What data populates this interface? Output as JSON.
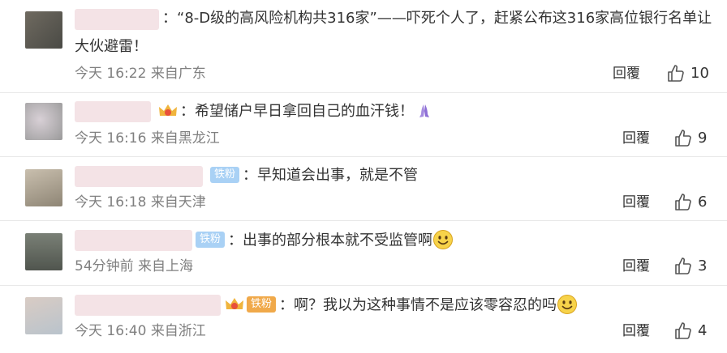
{
  "comments": [
    {
      "separator": "：",
      "text": "“8-D级的高风险机构共316家”——吓死个人了，赶紧公布这316家高位银行名单让",
      "text2": "大伙避雷！",
      "time": "今天 16:22",
      "location": "来自广东",
      "reply_label": "回覆",
      "likes": "10"
    },
    {
      "separator": "：",
      "text": "希望储户早日拿回自己的血汗钱！",
      "time": "今天 16:16",
      "location": "来自黑龙江",
      "reply_label": "回覆",
      "likes": "9"
    },
    {
      "badge": "铁粉",
      "separator": "：",
      "text": "早知道会出事，就是不管",
      "time": "今天 16:18",
      "location": "来自天津",
      "reply_label": "回覆",
      "likes": "6"
    },
    {
      "badge": "铁粉",
      "separator": "：",
      "text": "出事的部分根本就不受监管啊",
      "time": "54分钟前",
      "location": "来自上海",
      "reply_label": "回覆",
      "likes": "3"
    },
    {
      "badge": "铁粉",
      "separator": "：",
      "text": "啊？我以为这种事情不是应该零容忍的吗",
      "time": "今天 16:40",
      "location": "来自浙江",
      "reply_label": "回覆",
      "likes": "4"
    }
  ],
  "colors": {
    "badge": "#a9d1f5",
    "meta_text": "#808080",
    "name_blur": "#f4e3e6",
    "divider": "#e8e8e8"
  },
  "icons": [
    "thumb-up-icon",
    "smiley-icon",
    "crown-icon",
    "pray-icon"
  ]
}
